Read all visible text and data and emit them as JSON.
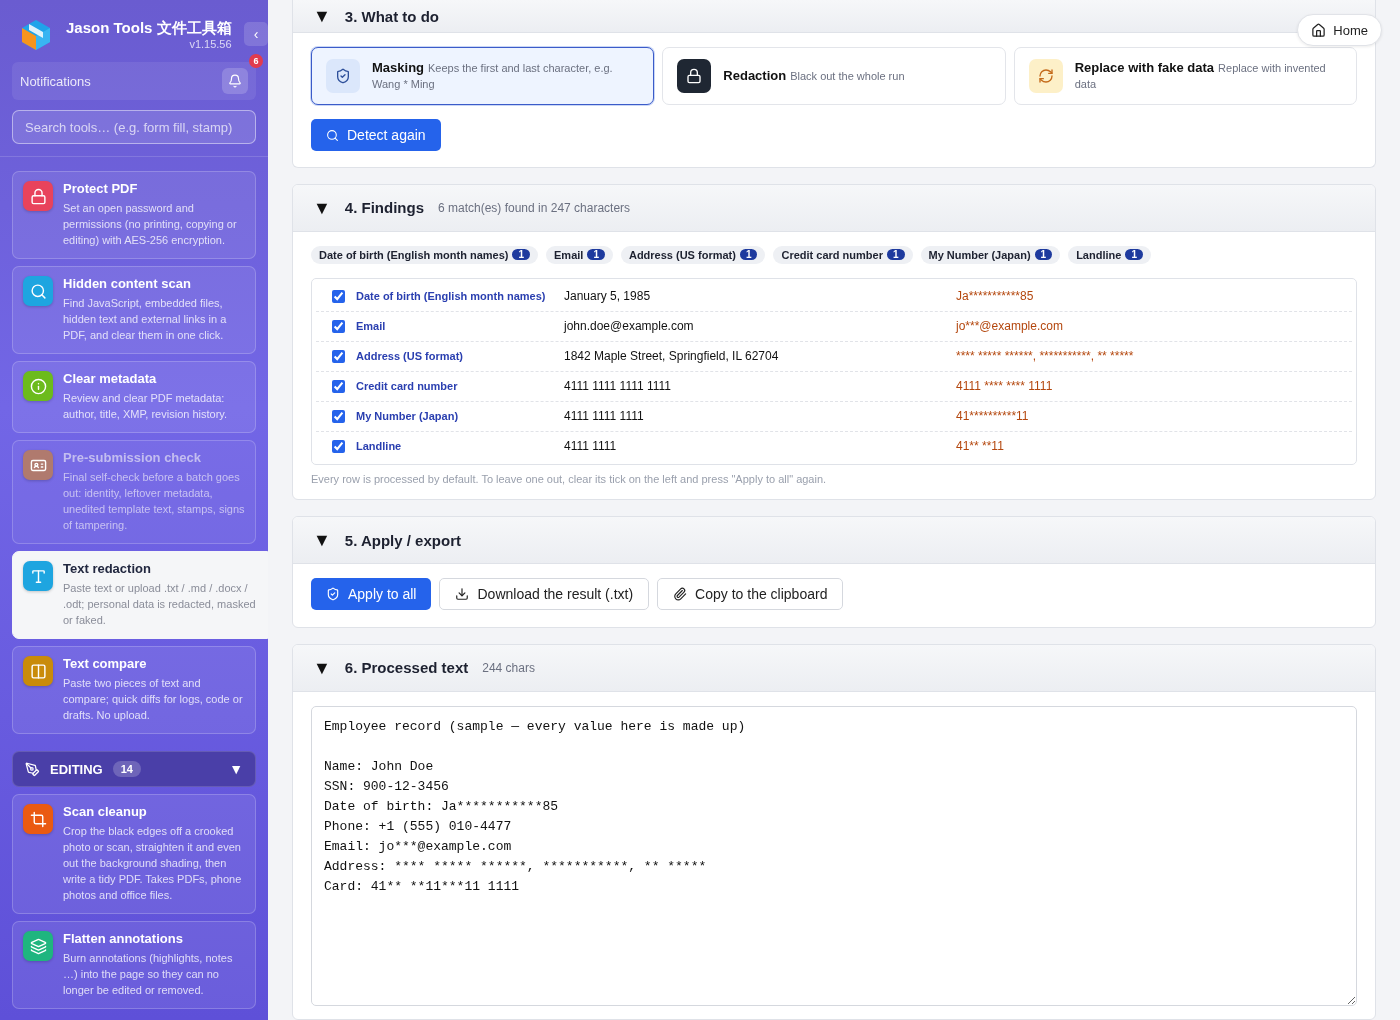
{
  "sidebar": {
    "app_title": "Jason Tools 文件工具箱",
    "version": "v1.15.56",
    "collapse": "‹",
    "notifications": {
      "label": "Notifications",
      "count": "6"
    },
    "search": {
      "placeholder": "Search tools… (e.g. form fill, stamp)"
    },
    "items": [
      {
        "kind": "lock",
        "color": "#e8435c",
        "title": "Protect PDF",
        "desc": "Set an open password and permissions (no printing, copying or editing) with AES-256 encryption.",
        "selected": false,
        "disabled": false
      },
      {
        "kind": "search",
        "color": "#1ea5e0",
        "title": "Hidden content scan",
        "desc": "Find JavaScript, embedded files, hidden text and external links in a PDF, and clear them in one click.",
        "selected": false,
        "disabled": false
      },
      {
        "kind": "info",
        "color": "#6cbb1c",
        "title": "Clear metadata",
        "desc": "Review and clear PDF metadata: author, title, XMP, revision history.",
        "selected": false,
        "disabled": false
      },
      {
        "kind": "idcard",
        "color": "#b07a6e",
        "title": "Pre-submission check",
        "desc": "Final self-check before a batch goes out: identity, leftover metadata, unedited template text, stamps, signs of tampering.",
        "selected": false,
        "disabled": true
      },
      {
        "kind": "type",
        "color": "#1ea5e0",
        "title": "Text redaction",
        "desc": "Paste text or upload .txt / .md / .docx / .odt; personal data is redacted, masked or faked.",
        "selected": true,
        "disabled": false
      },
      {
        "kind": "columns",
        "color": "#c98b0a",
        "title": "Text compare",
        "desc": "Paste two pieces of text and compare; quick diffs for logs, code or drafts. No upload.",
        "selected": false,
        "disabled": false
      }
    ],
    "group": {
      "label": "EDITING",
      "count": "14",
      "toggle": "▼",
      "expanded": true,
      "items": [
        {
          "kind": "crop",
          "color": "#ea5a12",
          "title": "Scan cleanup",
          "desc": "Crop the black edges off a crooked photo or scan, straighten it and even out the background shading, then write a tidy PDF. Takes PDFs, phone photos and office files.",
          "selected": false,
          "disabled": false
        },
        {
          "kind": "layers",
          "color": "#1fb57f",
          "title": "Flatten annotations",
          "desc": "Burn annotations (highlights, notes …) into the page so they can no longer be edited or removed.",
          "selected": false,
          "disabled": false
        }
      ]
    }
  },
  "home_button": "Home",
  "what_to_do": {
    "toggle": "▼",
    "title": "3. What to do",
    "options": [
      {
        "kind": "shield",
        "title": "Masking",
        "desc": "Keeps the first and last character, e.g. Wang * Ming",
        "selected": true
      },
      {
        "kind": "lock",
        "title": "Redaction",
        "desc": "Black out the whole run",
        "selected": false
      },
      {
        "kind": "refresh",
        "title": "Replace with fake data",
        "desc": "Replace with invented data",
        "selected": false
      }
    ],
    "button": "Detect again"
  },
  "findings": {
    "toggle": "▼",
    "title": "4. Findings",
    "summary": "6 match(es) found in 247 characters",
    "chips": [
      {
        "label": "Date of birth (English month names)",
        "count": "1"
      },
      {
        "label": "Email",
        "count": "1"
      },
      {
        "label": "Address (US format)",
        "count": "1"
      },
      {
        "label": "Credit card number",
        "count": "1"
      },
      {
        "label": "My Number (Japan)",
        "count": "1"
      },
      {
        "label": "Landline",
        "count": "1"
      }
    ],
    "rows": [
      {
        "checked": true,
        "type": "Date of birth (English month names)",
        "original": "January 5, 1985",
        "masked": "Ja***********85"
      },
      {
        "checked": true,
        "type": "Email",
        "original": "john.doe@example.com",
        "masked": "jo***@example.com"
      },
      {
        "checked": true,
        "type": "Address (US format)",
        "original": "1842 Maple Street, Springfield, IL 62704",
        "masked": "**** ***** ******, ***********, ** *****"
      },
      {
        "checked": true,
        "type": "Credit card number",
        "original": "4111 1111 1111 1111",
        "masked": "4111 **** **** 1111"
      },
      {
        "checked": true,
        "type": "My Number (Japan)",
        "original": "4111 1111 1111",
        "masked": "41**********11"
      },
      {
        "checked": true,
        "type": "Landline",
        "original": "4111 1111",
        "masked": "41** **11"
      }
    ],
    "note": "Every row is processed by default. To leave one out, clear its tick on the left and press \"Apply to all\" again."
  },
  "apply": {
    "toggle": "▼",
    "title": "5. Apply / export",
    "buttons": [
      {
        "kind": "apply",
        "label": "Apply to all"
      },
      {
        "kind": "download",
        "label": "Download the result (.txt)"
      },
      {
        "kind": "copy",
        "label": "Copy to the clipboard"
      }
    ]
  },
  "processed": {
    "toggle": "▼",
    "title": "6. Processed text",
    "count": "244 chars",
    "text": "Employee record (sample — every value here is made up)\n\nName: John Doe\nSSN: 900-12-3456\nDate of birth: Ja***********85\nPhone: +1 (555) 010-4477\nEmail: jo***@example.com\nAddress: **** ***** ******, ***********, ** *****\nCard: 41** **11***11 1111"
  }
}
